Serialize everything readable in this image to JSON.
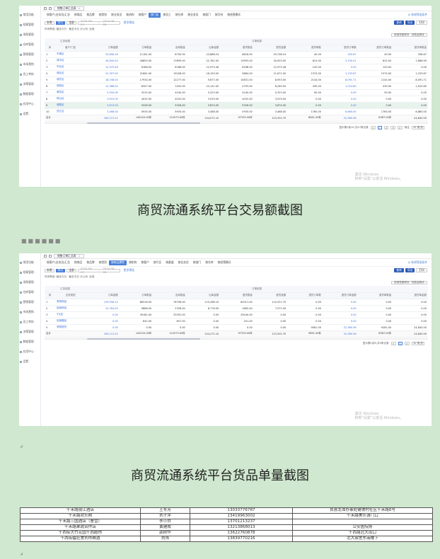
{
  "app": {
    "sidebar": [
      "常用功能",
      "档案管理",
      "采购管理",
      "仓库管理",
      "营销管理",
      "市场营销",
      "员工考核",
      "决策管理",
      "数据管理",
      "应用中心",
      "设置"
    ],
    "open_tab": "销售订单汇总表",
    "filter": {
      "segments": [
        "本周",
        "本月",
        "全部"
      ],
      "date_from": "2024-06-23",
      "date_to": "2024-06-28",
      "advanced": "更多筛选",
      "btn_query": "查询",
      "btn_export": "导出",
      "btn_print": "打印"
    },
    "breadcrumb": "时间筛选: 截至今日 · 截至今日  分公司: 全部",
    "sort_select": "按销售额降序 · 按数量降序",
    "right_link": "◎ 修改筛选条件",
    "watermark_line1": "激活 Windows",
    "watermark_line2": "转到\"设置\"以激活 Windows。"
  },
  "shot1": {
    "nav": [
      "按客户|业务员|汇总",
      "按商品",
      "按品牌",
      "按类别",
      "按业务员",
      "按机构",
      "按客户",
      "按门店",
      "按员工",
      "按仓库",
      "按业务员",
      "按部门",
      "按月份",
      "按经营模式"
    ],
    "active_nav": 7,
    "headers": [
      "序",
      "客户/门店",
      "订单金额",
      "订单数量",
      "出库数量",
      "出库金额",
      "退货数量",
      "退货金额",
      "退货单数",
      "退货订单数",
      "退货订单数量",
      "退货单数量",
      "退货订单金额"
    ],
    "group_headers": [
      "汇总信息",
      "订单信息"
    ],
    "rows": [
      [
        "1",
        "市南区",
        "33,856.16",
        "11161.00",
        "8700.00",
        "23,888.24",
        "8618.00",
        "29,708.24",
        "40.00",
        "355.67",
        "40.00",
        "358.67"
      ],
      [
        "2",
        "城中区",
        "49,840.00",
        "28893.00",
        "17899.00",
        "22,781.00",
        "13993.00",
        "16,903.00",
        "814.00",
        "2,190.01",
        "822.00",
        "1,668.99"
      ],
      [
        "3",
        "市北区",
        "12,975.46",
        "8188.00",
        "8188.00",
        "12,975.46",
        "8188.00",
        "12,975.46",
        "120.00",
        "0.00",
        "120.00",
        "0.00"
      ],
      [
        "4",
        "城北区",
        "22,307.00",
        "21661.00",
        "19208.00",
        "18,150.00",
        "9684.00",
        "11,671.00",
        "1370.00",
        "1,233.87",
        "1370.00",
        "1,233.87"
      ],
      [
        "5",
        "城东区",
        "18,338.00",
        "17934.00",
        "12277.00",
        "9,877.00",
        "10631.00",
        "8,953.00",
        "2144.00",
        "8,091.71",
        "2144.00",
        "8,091.71"
      ],
      [
        "6",
        "城西区",
        "12,388.00",
        "8307.00",
        "7492.00",
        "10,141.00",
        "4793.00",
        "6,285.00",
        "430.00",
        "1,024.80",
        "430.00",
        "1,024.80"
      ],
      [
        "7",
        "黄岛区",
        "5,350.00",
        "4315.00",
        "4240.00",
        "5,323.00",
        "4240.00",
        "5,323.00",
        "90.00",
        "0.00",
        "90.00",
        "0.00"
      ],
      [
        "8",
        "崂山区",
        "3,919.00",
        "4032.00",
        "4032.00",
        "3,919.00",
        "4032.00",
        "3,919.00",
        "0.00",
        "0.00",
        "0.00",
        "0.00"
      ],
      [
        "9",
        "城阳区",
        "3,874.00",
        "5326.00",
        "5326.00",
        "3,874.00",
        "5326.00",
        "3,874.00",
        "0.00",
        "0.00",
        "0.00",
        "0.00"
      ],
      [
        "10",
        "西江区",
        "3,468.00",
        "5935.00",
        "5935.00",
        "3,468.00",
        "5935.00",
        "3,468.00",
        "1760.00",
        "6,860.00",
        "1760.00",
        "6,860.00"
      ]
    ],
    "highlight_row": 8,
    "total": [
      "合计",
      "",
      "160,113.22",
      "140220.00件",
      "112073.00件",
      "144,072.10",
      "97335.00件",
      "123,302.70",
      "8581.00件",
      "22,380.56",
      "8387.00件",
      "24,840.50"
    ],
    "pager": {
      "total_text": "显示第1到10,共27条记录",
      "pages": [
        "<",
        "1",
        "2",
        "3",
        ">"
      ],
      "goto_label": "前往",
      "per_page": "10 条/页"
    }
  },
  "caption1": "商贸流通系统平台交易额截图",
  "shot2": {
    "nav": [
      "按客户|业务员|汇总",
      "按商品",
      "按品牌",
      "按类别",
      "按商品属性",
      "按机构",
      "按客户",
      "按片区",
      "按渠道",
      "按业务员",
      "按部门",
      "按仓库",
      "按经营模式"
    ],
    "active_nav": 4,
    "headers": [
      "序",
      "业务类型",
      "订单金额",
      "订单数量",
      "出库数量",
      "出库金额",
      "退货数量",
      "退货金额",
      "退货订单数",
      "退货订单金额",
      "退货单数量",
      "退货单金额"
    ],
    "group_headers": [
      "汇总信息",
      "订单信息"
    ],
    "rows": [
      [
        "1",
        "常规商品",
        "139,956.22",
        "88318.00",
        "76708.00",
        "125,286.10",
        "62011.00",
        "110,521.70",
        "0.00",
        "0.00",
        "0.00",
        "0.00"
      ],
      [
        "2",
        "促销商品",
        "12,764.00",
        "9888.00",
        "2328.00",
        "8,776.00",
        "1682.00",
        "7,571.00",
        "0.00",
        "0.00",
        "0.00",
        "0.00"
      ],
      [
        "3",
        "5元区",
        "0.00",
        "39182.00",
        "33352.00",
        "0.00",
        "29440.00",
        "0.00",
        "0.00",
        "0.00",
        "0.00",
        "0.00"
      ],
      [
        "4",
        "促销赠品",
        "0.00",
        "842.00",
        "657.00",
        "0.00",
        "201.00",
        "0.00",
        "0.00",
        "0.00",
        "0.00",
        "0.00"
      ],
      [
        "5",
        "常规退货",
        "0.00",
        "0.00",
        "0.00",
        "0.00",
        "0.00",
        "0.00",
        "9581.00",
        "22,380.56",
        "9281.00",
        "24,840.50"
      ]
    ],
    "total": [
      "合计",
      "",
      "160,113.22",
      "140220.00件",
      "112073.00件",
      "144,272.10",
      "97335.00件",
      "123,302.70",
      "9581.00件",
      "22,380.56",
      "8387.00件",
      "24,840.50"
    ],
    "pager": {
      "total_text": "显示第1到5,共5条记录",
      "pages": [
        "<",
        "1",
        ">"
      ],
      "per_page": "10 条/页"
    }
  },
  "caption2": "商贸流通系统平台货品单量截图",
  "contacts": [
    [
      "千禾路丽江酒店",
      "王冬芳",
      "13033776787",
      "良县龙潭办事处健坡村社区千禾路6号"
    ],
    [
      "千禾路欢乐购",
      "刘子萍",
      "13419963002",
      "千禾路美乐请门口"
    ],
    [
      "千禾路三国酒店（曹营）",
      "李小白",
      "13701213237",
      ""
    ],
    [
      "千禾路果蔬合作店",
      "黄建成",
      "13213868013",
      "公安医院旁"
    ],
    [
      "千西街大竹花园千西超市",
      "邵树华",
      "13622760878",
      "千西路北大出口"
    ],
    [
      "千西街福壮食刘市粮酒",
      "刘伟",
      "13839770216",
      "北大宿舍东商楼下"
    ]
  ]
}
